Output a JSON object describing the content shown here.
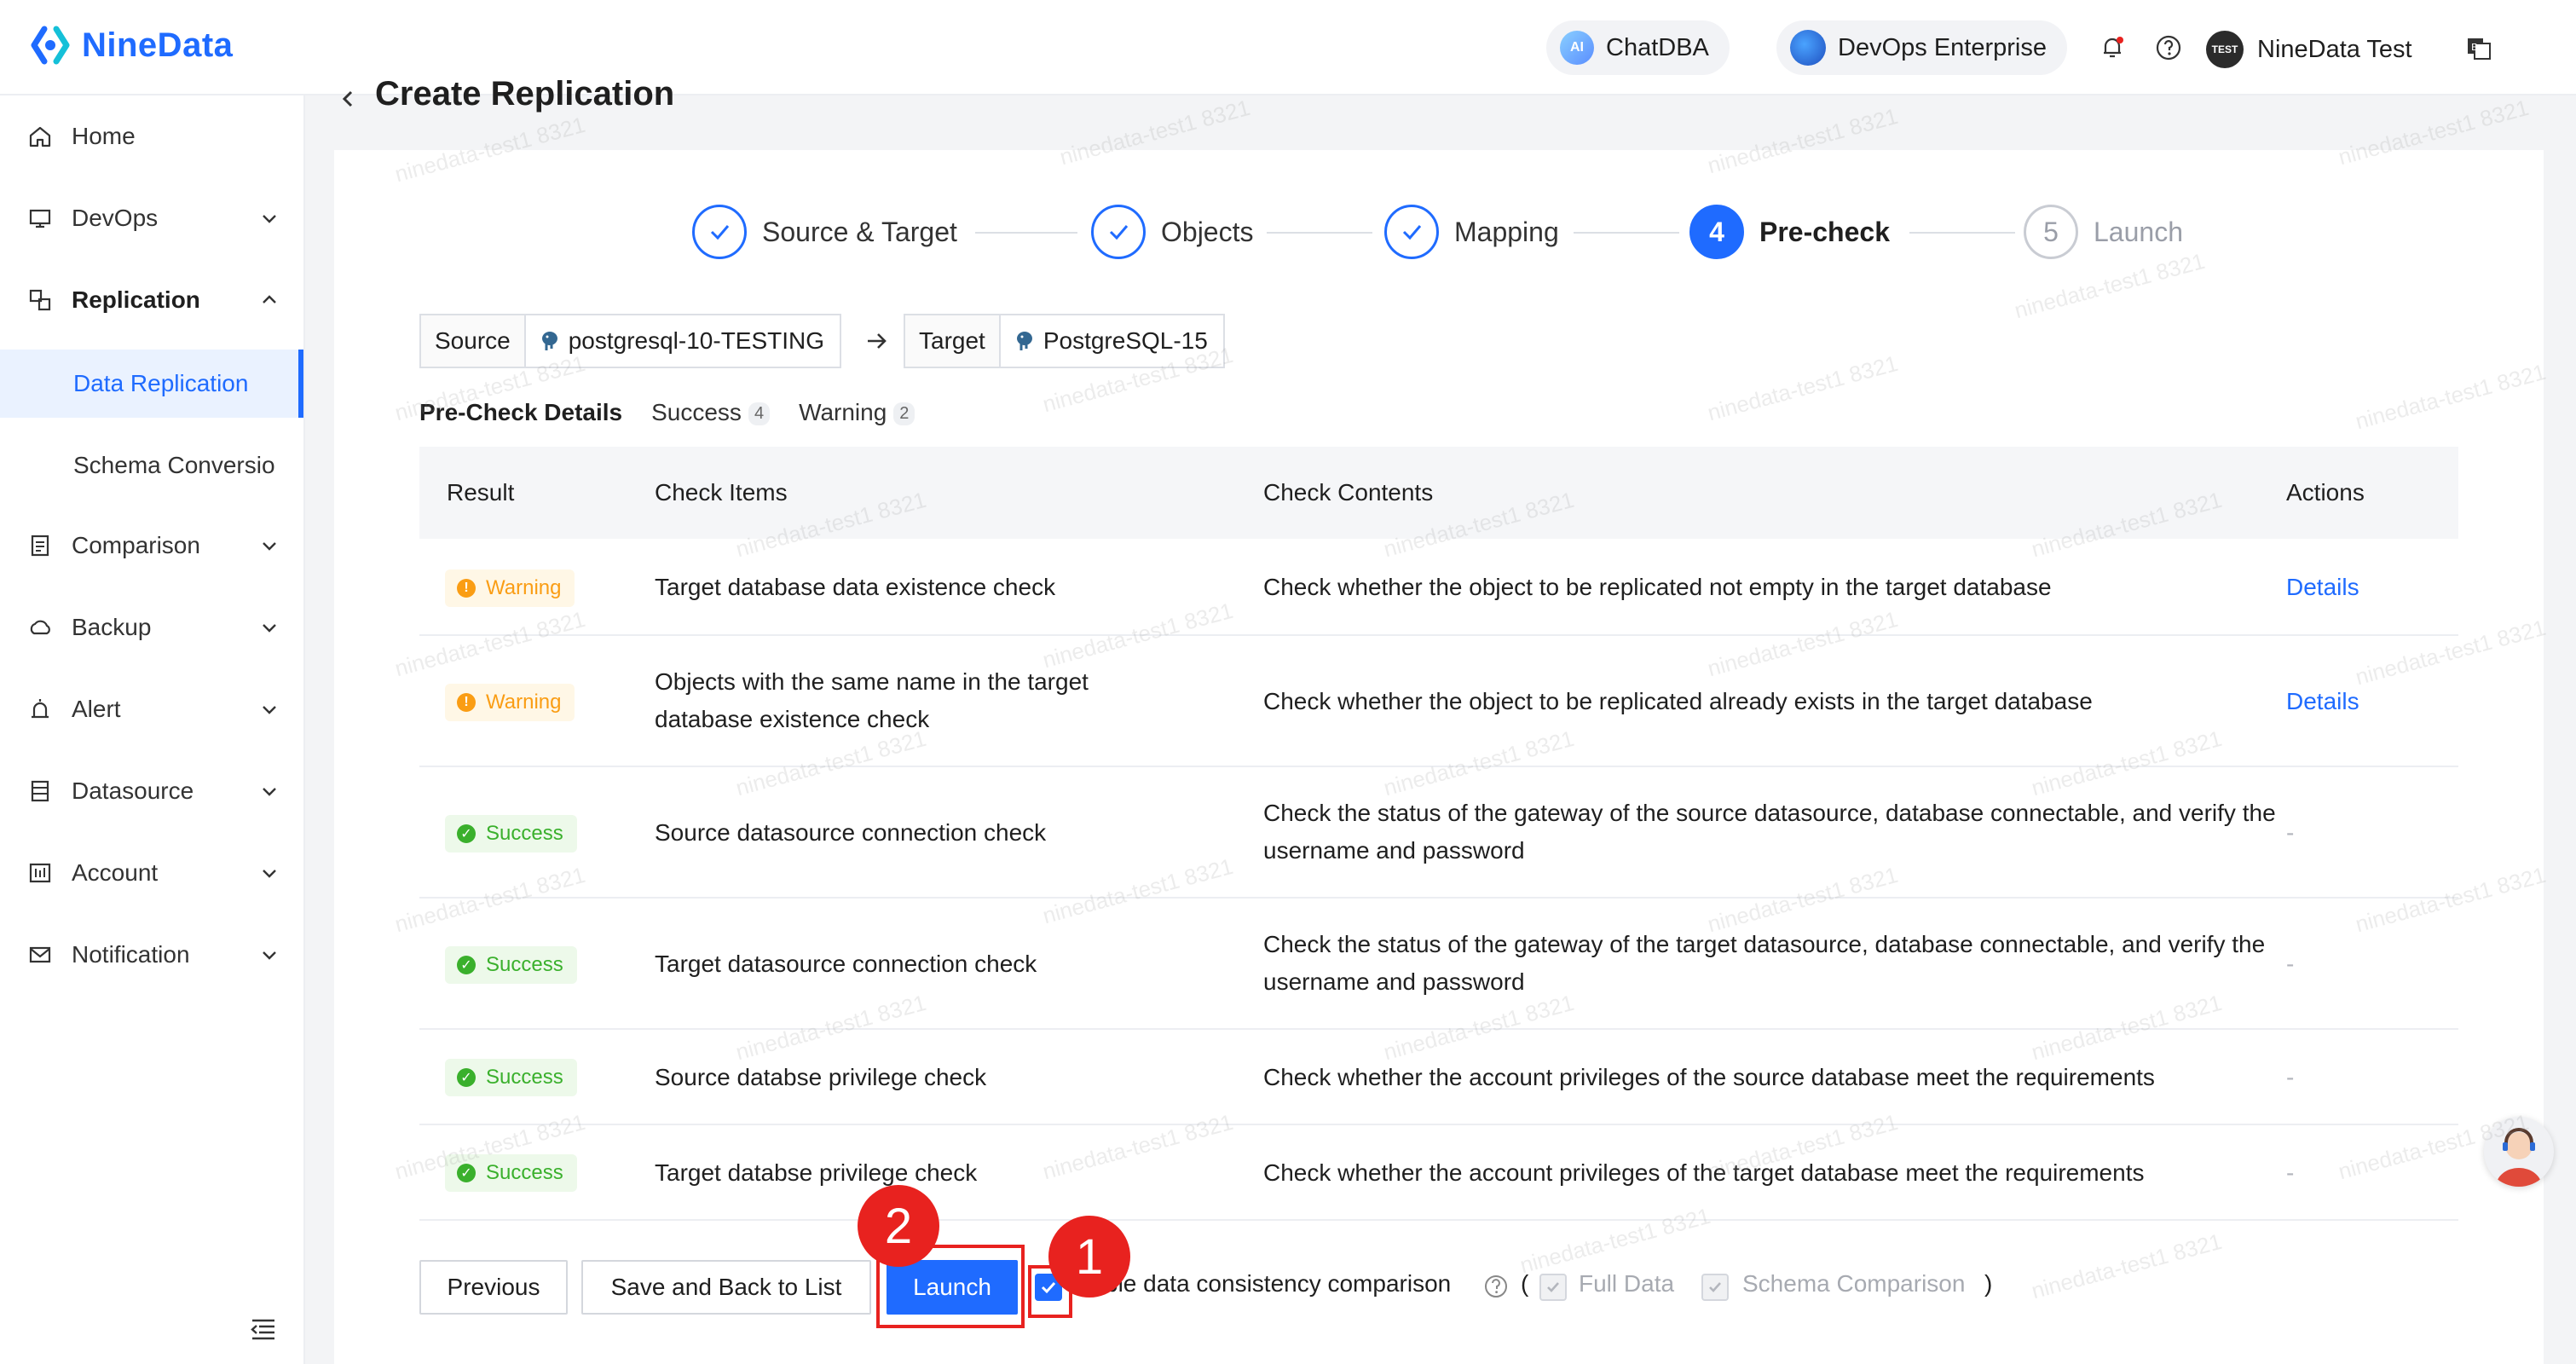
{
  "header": {
    "brand": "NineData",
    "chatdba_label": "ChatDBA",
    "devops_label": "DevOps Enterprise",
    "user_name": "NineData Test",
    "avatar_text": "TEST"
  },
  "sidebar": {
    "items": [
      {
        "label": "Home",
        "icon": "home-icon"
      },
      {
        "label": "DevOps",
        "icon": "devops-icon"
      },
      {
        "label": "Replication",
        "icon": "replication-icon"
      },
      {
        "label": "Comparison",
        "icon": "comparison-icon"
      },
      {
        "label": "Backup",
        "icon": "backup-icon"
      },
      {
        "label": "Alert",
        "icon": "alert-icon"
      },
      {
        "label": "Datasource",
        "icon": "datasource-icon"
      },
      {
        "label": "Account",
        "icon": "account-icon"
      },
      {
        "label": "Notification",
        "icon": "notification-icon"
      }
    ],
    "sub_items": [
      "Data Replication",
      "Schema Conversio"
    ]
  },
  "page": {
    "title": "Create Replication"
  },
  "steps": [
    {
      "label": "Source & Target",
      "status": "done"
    },
    {
      "label": "Objects",
      "status": "done"
    },
    {
      "label": "Mapping",
      "status": "done"
    },
    {
      "label": "Pre-check",
      "status": "active",
      "number": "4"
    },
    {
      "label": "Launch",
      "status": "pending",
      "number": "5"
    }
  ],
  "source_target": {
    "source_label": "Source",
    "source_value": "postgresql-10-TESTING",
    "target_label": "Target",
    "target_value": "PostgreSQL-15"
  },
  "tabs": {
    "details": "Pre-Check Details",
    "success": "Success",
    "success_count": "4",
    "warning": "Warning",
    "warning_count": "2"
  },
  "table": {
    "headers": [
      "Result",
      "Check Items",
      "Check Contents",
      "Actions"
    ],
    "rows": [
      {
        "result": "Warning",
        "item": "Target database data existence check",
        "content": "Check whether the object to be replicated not empty in the target database",
        "action": "Details"
      },
      {
        "result": "Warning",
        "item": "Objects with the same name in the target database existence check",
        "content": "Check whether the object to be replicated already exists in the target database",
        "action": "Details"
      },
      {
        "result": "Success",
        "item": "Source datasource connection check",
        "content": "Check the status of the gateway of the source datasource, database connectable, and verify the username and password",
        "action": "-"
      },
      {
        "result": "Success",
        "item": "Target datasource connection check",
        "content": "Check the status of the gateway of the target datasource, database connectable, and verify the username and password",
        "action": "-"
      },
      {
        "result": "Success",
        "item": "Source databse privilege check",
        "content": "Check whether the account privileges of the source database meet the requirements",
        "action": "-"
      },
      {
        "result": "Success",
        "item": "Target databse privilege check",
        "content": "Check whether the account privileges of the target database meet the requirements",
        "action": "-"
      }
    ]
  },
  "footer": {
    "previous": "Previous",
    "save_back": "Save and Back to List",
    "launch": "Launch",
    "consistency_label": "ble data consistency comparison",
    "paren_open": "(",
    "full_data": "Full Data",
    "schema_comparison": "Schema Comparison",
    "paren_close": ")"
  },
  "annotations": {
    "marker_1": "1",
    "marker_2": "2",
    "color": "#e8221f"
  },
  "watermark": "ninedata-test1 8321",
  "colors": {
    "accent": "#1f6bff",
    "warning": "#fa9d14",
    "success": "#3ab02c"
  }
}
